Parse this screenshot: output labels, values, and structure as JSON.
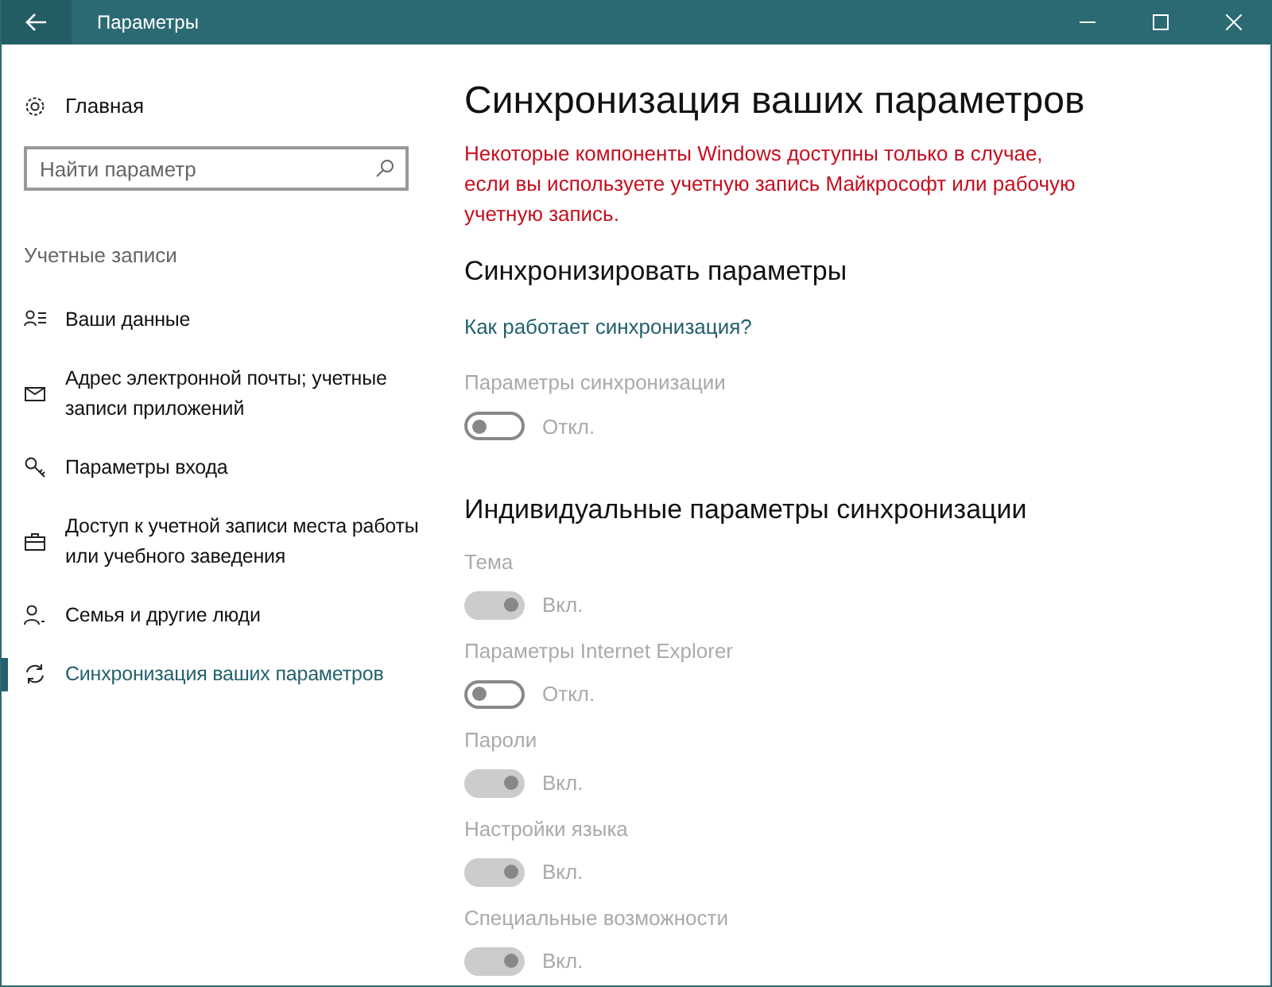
{
  "window": {
    "title": "Параметры"
  },
  "sidebar": {
    "home": "Главная",
    "search": {
      "placeholder": "Найти параметр"
    },
    "section": "Учетные записи",
    "items": [
      {
        "kind": "person-list",
        "label": "Ваши данные",
        "selected": false
      },
      {
        "kind": "mail",
        "label": "Адрес электронной почты; учетные записи приложений",
        "selected": false
      },
      {
        "kind": "key",
        "label": "Параметры входа",
        "selected": false
      },
      {
        "kind": "briefcase",
        "label": "Доступ к учетной записи места работы или учебного заведения",
        "selected": false
      },
      {
        "kind": "person-add",
        "label": "Семья и другие люди",
        "selected": false
      },
      {
        "kind": "sync",
        "label": "Синхронизация ваших параметров",
        "selected": true
      }
    ]
  },
  "content": {
    "title": "Синхронизация ваших параметров",
    "warning": "Некоторые компоненты Windows доступны только в случае, если вы используете учетную запись Майкрософт или рабочую учетную запись.",
    "sync_heading": "Синхронизировать параметры",
    "link": "Как работает синхронизация?",
    "master": {
      "label": "Параметры синхронизации",
      "on": false,
      "disabled": true,
      "state": "Откл."
    },
    "individual_heading": "Индивидуальные параметры синхронизации",
    "settings": [
      {
        "label": "Тема",
        "on": true,
        "disabled": true,
        "state": "Вкл."
      },
      {
        "label": "Параметры Internet Explorer",
        "on": false,
        "disabled": true,
        "state": "Откл."
      },
      {
        "label": "Пароли",
        "on": true,
        "disabled": true,
        "state": "Вкл."
      },
      {
        "label": "Настройки языка",
        "on": true,
        "disabled": true,
        "state": "Вкл."
      },
      {
        "label": "Специальные возможности",
        "on": true,
        "disabled": true,
        "state": "Вкл."
      }
    ]
  }
}
